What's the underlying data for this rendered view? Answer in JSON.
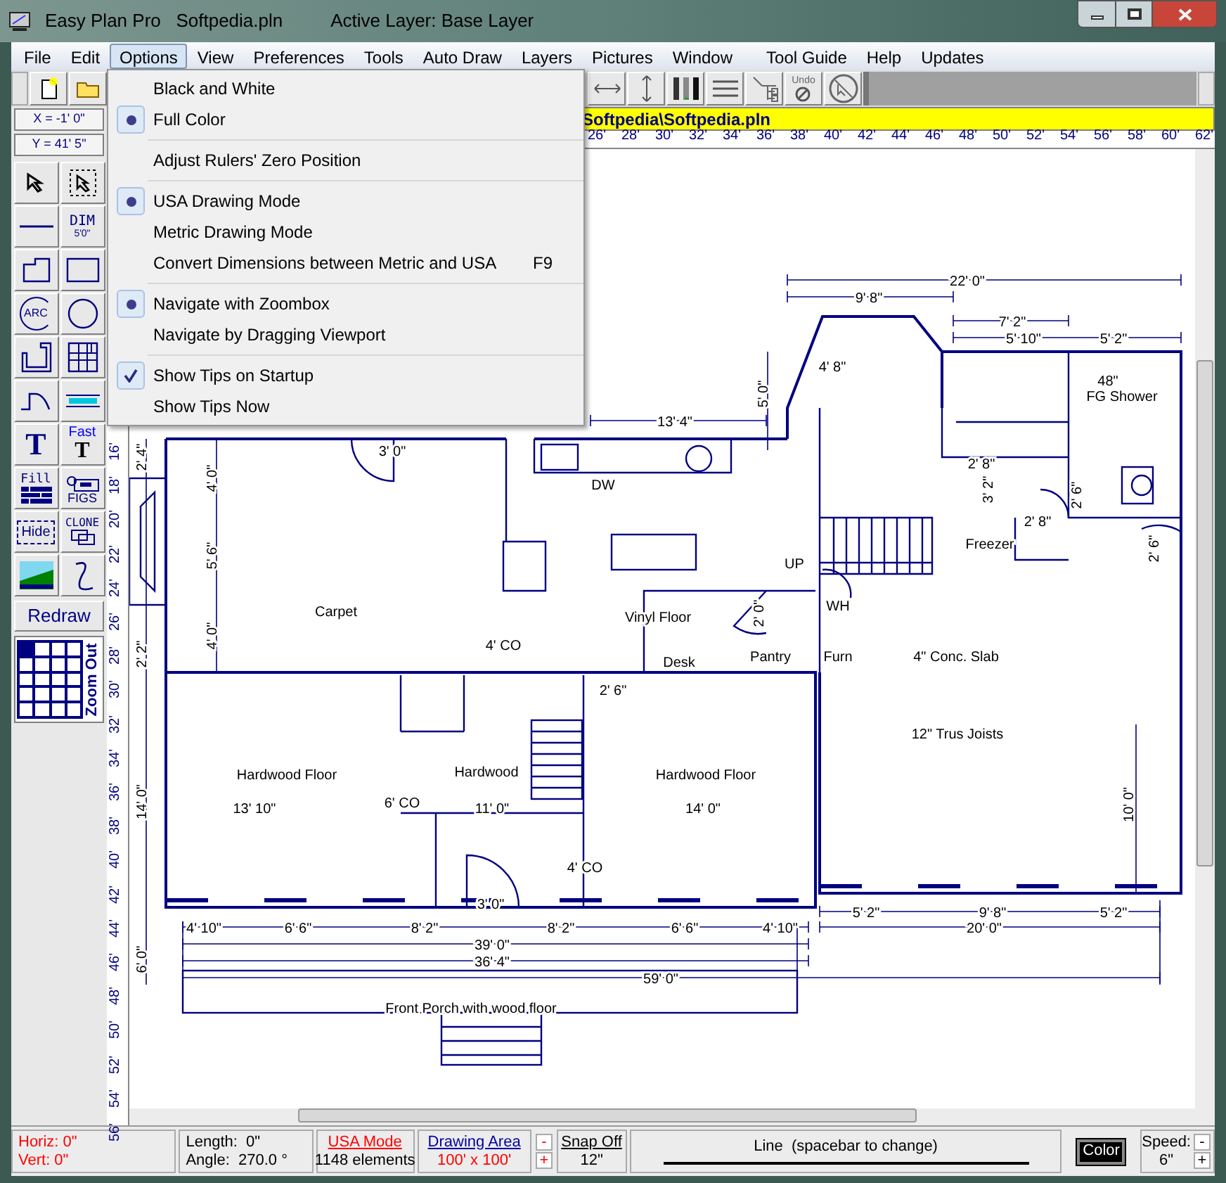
{
  "window": {
    "title": "Easy Plan Pro   Softpedia.pln",
    "layer": "Active Layer: Base Layer"
  },
  "menu": [
    {
      "label": "File",
      "selected": false
    },
    {
      "label": "Edit",
      "selected": false
    },
    {
      "label": "Options",
      "selected": true
    },
    {
      "label": "View",
      "selected": false
    },
    {
      "label": "Preferences",
      "selected": false
    },
    {
      "label": "Tools",
      "selected": false
    },
    {
      "label": "Auto Draw",
      "selected": false
    },
    {
      "label": "Layers",
      "selected": false
    },
    {
      "label": "Pictures",
      "selected": false
    },
    {
      "label": "Window",
      "selected": false
    },
    {
      "label": "Tool Guide",
      "selected": false
    },
    {
      "label": "Help",
      "selected": false
    },
    {
      "label": "Updates",
      "selected": false
    }
  ],
  "options_menu": {
    "sections": [
      {
        "items": [
          {
            "label": "Black and White",
            "kind": "radio",
            "checked": false
          },
          {
            "label": "Full Color",
            "kind": "radio",
            "checked": true
          }
        ]
      },
      {
        "items": [
          {
            "label": "Adjust Rulers' Zero Position",
            "kind": "plain"
          }
        ]
      },
      {
        "items": [
          {
            "label": "USA Drawing Mode",
            "kind": "radio",
            "checked": true
          },
          {
            "label": "Metric Drawing Mode",
            "kind": "radio",
            "checked": false
          },
          {
            "label": "Convert Dimensions between Metric and USA",
            "kind": "plain",
            "shortcut": "F9"
          }
        ]
      },
      {
        "items": [
          {
            "label": "Navigate with Zoombox",
            "kind": "radio",
            "checked": true
          },
          {
            "label": "Navigate by Dragging Viewport",
            "kind": "radio",
            "checked": false
          }
        ]
      },
      {
        "items": [
          {
            "label": "Show Tips on Startup",
            "kind": "check",
            "checked": true
          },
          {
            "label": "Show Tips Now",
            "kind": "plain"
          }
        ]
      }
    ]
  },
  "toolbar": [
    {
      "kind": "new"
    },
    {
      "kind": "open"
    },
    {
      "kind": "hsize"
    },
    {
      "kind": "vsize"
    },
    {
      "kind": "columns"
    },
    {
      "kind": "lines"
    },
    {
      "kind": "tree"
    },
    {
      "kind": "undo",
      "label": "Undo"
    },
    {
      "kind": "nopointer"
    }
  ],
  "coordinates": [
    "X = -1' 0\"",
    "Y = 41' 5\""
  ],
  "path_bar": "Softpedia\\Softpedia.pln",
  "ruler_top": [
    "26'",
    "28'",
    "30'",
    "32'",
    "34'",
    "36'",
    "38'",
    "40'",
    "42'",
    "44'",
    "46'",
    "48'",
    "50'",
    "52'",
    "54'",
    "56'",
    "58'",
    "60'",
    "62'"
  ],
  "ruler_left": [
    "16'",
    "18'",
    "20'",
    "22'",
    "24'",
    "26'",
    "28'",
    "30'",
    "32'",
    "34'",
    "36'",
    "38'",
    "40'",
    "42'",
    "44'",
    "46'",
    "48'",
    "50'",
    "52'",
    "54'",
    "56'"
  ],
  "tools": [
    {
      "kind": "pointer"
    },
    {
      "kind": "window-select"
    },
    {
      "kind": "line"
    },
    {
      "kind": "dim",
      "labels": [
        "DIM",
        "5'0\""
      ]
    },
    {
      "kind": "polygon"
    },
    {
      "kind": "rect"
    },
    {
      "kind": "arc",
      "labels": [
        "ARC"
      ]
    },
    {
      "kind": "circle"
    },
    {
      "kind": "room"
    },
    {
      "kind": "cabinet"
    },
    {
      "kind": "door"
    },
    {
      "kind": "window"
    },
    {
      "kind": "text",
      "labels": [
        "T"
      ]
    },
    {
      "kind": "fast-text",
      "labels": [
        "Fast",
        "T"
      ]
    },
    {
      "kind": "fill",
      "labels": [
        "Fill"
      ]
    },
    {
      "kind": "figs",
      "labels": [
        "FIGS"
      ]
    },
    {
      "kind": "hide",
      "labels": [
        "Hide"
      ]
    },
    {
      "kind": "clone",
      "labels": [
        "CLONE"
      ]
    },
    {
      "kind": "picture"
    },
    {
      "kind": "curve"
    }
  ],
  "redraw": "Redraw",
  "zoom": {
    "label": "Zoom Out",
    "cells": [
      {
        "selected": true
      },
      {
        "selected": false
      },
      {
        "selected": false
      },
      {
        "selected": false
      },
      {
        "selected": false
      },
      {
        "selected": false
      },
      {
        "selected": false
      },
      {
        "selected": false
      },
      {
        "selected": false
      },
      {
        "selected": false
      },
      {
        "selected": false
      },
      {
        "selected": false
      },
      {
        "selected": false
      },
      {
        "selected": false
      },
      {
        "selected": false
      },
      {
        "selected": false
      },
      {
        "selected": false
      },
      {
        "selected": false
      },
      {
        "selected": false
      },
      {
        "selected": false
      }
    ]
  },
  "plan_labels": [
    "22' 0\"",
    "9' 8\"",
    "7' 2\"",
    "5' 10\"",
    "5' 2\"",
    "4' 8\"",
    "5' 0\"",
    "13' 4\"",
    "48\"",
    "FG Shower",
    "3' 0\"",
    "DW",
    "2' 8\"",
    "3' 2\"",
    "2' 8\"",
    "2' 6\"",
    "Freezer",
    "2' 6\"",
    "UP",
    "Carpet",
    "Vinyl Floor",
    "2' 0\"",
    "WH",
    "4' CO",
    "Desk",
    "Pantry",
    "Furn",
    "4\" Conc. Slab",
    "2' 6\"",
    "12\" Trus Joists",
    "Hardwood Floor",
    "Hardwood",
    "Hardwood Floor",
    "13' 10\"",
    "6' CO",
    "11' 0\"",
    "14' 0\"",
    "10' 0\"",
    "4' CO",
    "3' 0\"",
    "5' 2\"",
    "9' 8\"",
    "5' 2\"",
    "4' 10\"",
    "6' 6\"",
    "8' 2\"",
    "8' 2\"",
    "6' 6\"",
    "4' 10\"",
    "20' 0\"",
    "39' 0\"",
    "36' 4\"",
    "59' 0\"",
    "Front Porch with wood floor",
    "4' 0\"",
    "5' 6\"",
    "4' 0\"",
    "2' 4\"",
    "2' 2\"",
    "14' 0\"",
    "6' 0\""
  ],
  "status": {
    "horiz": "Horiz: 0\"",
    "vert": "Vert: 0\"",
    "length": "Length:  0\"",
    "angle": "Angle:  270.0 °",
    "mode": "USA Mode",
    "elements": "1148 elements",
    "area_label": "Drawing Area",
    "area": "100' x 100'",
    "area_minus": "-",
    "area_plus": "+",
    "snap": "Snap Off",
    "snap_value": "12\"",
    "line_mode": "Line  (spacebar to change)",
    "color_button": "Color",
    "speed_label": "Speed:",
    "speed": "6\"",
    "speed_minus": "-",
    "speed_plus": "+"
  }
}
